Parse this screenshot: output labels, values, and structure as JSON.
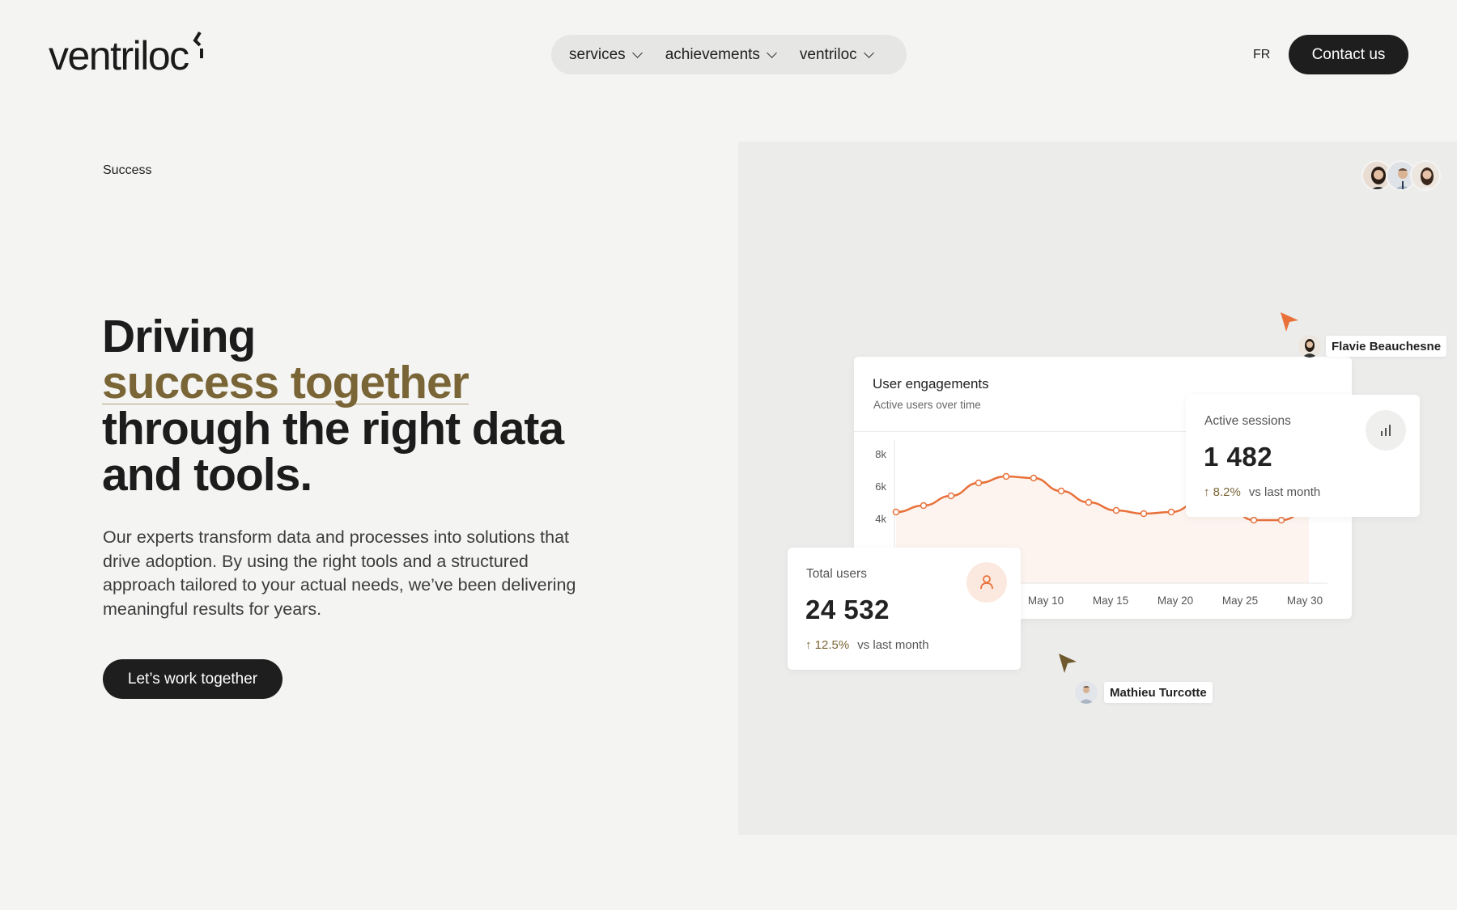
{
  "header": {
    "logo": "ventriloc",
    "logo_mark": "ɾ",
    "nav": [
      {
        "label": "services"
      },
      {
        "label": "achievements"
      },
      {
        "label": "ventriloc"
      }
    ],
    "lang": "FR",
    "contact": "Contact us"
  },
  "hero": {
    "eyebrow": "Success",
    "headline_line1": "Driving",
    "headline_accent": "success together",
    "headline_line3": "through the right data",
    "headline_line4": "and tools.",
    "body": "Our experts transform data and processes into solutions that drive adoption. By using the right tools and a structured approach tailored to your actual needs, we’ve been delivering meaningful results for years.",
    "cta": "Let’s work together"
  },
  "illustration": {
    "engagement_card": {
      "title": "User engagements",
      "subtitle": "Active users over time"
    },
    "active_sessions": {
      "label": "Active sessions",
      "value": "1 482",
      "trend": "↑ 8.2%",
      "note": "vs last month",
      "icon": "bar-chart-icon"
    },
    "total_users": {
      "label": "Total users",
      "value": "24 532",
      "trend": "↑ 12.5%",
      "note": "vs last month",
      "icon": "user-icon"
    },
    "collaborators": [
      {
        "name": "Flavie Beauchesne",
        "cursor_color": "#e8713a"
      },
      {
        "name": "Mathieu Turcotte",
        "cursor_color": "#6e5a2e"
      }
    ]
  },
  "colors": {
    "accent_gold": "#7a6536",
    "chart_orange": "#e8713a",
    "dark": "#1e1e1e"
  },
  "chart_data": {
    "type": "area",
    "title": "User engagements",
    "subtitle": "Active users over time",
    "y_ticks": [
      "4k",
      "6k",
      "8k"
    ],
    "x_ticks": [
      "May 10",
      "May 15",
      "May 20",
      "May 25",
      "May 30"
    ],
    "ylim": [
      0,
      8000
    ],
    "series": [
      {
        "values": [
          4400,
          4800,
          5400,
          6200,
          6600,
          6500,
          5700,
          5000,
          4500,
          4300,
          4400,
          5000,
          4800,
          3900,
          3900,
          4500
        ]
      }
    ]
  }
}
